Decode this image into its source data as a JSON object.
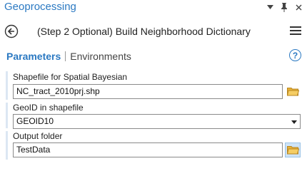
{
  "window": {
    "title": "Geoprocessing"
  },
  "header": {
    "tool_title": "(Step 2 Optional) Build Neighborhood Dictionary"
  },
  "tabs": [
    {
      "label": "Parameters",
      "active": true
    },
    {
      "label": "Environments",
      "active": false
    }
  ],
  "help_glyph": "?",
  "parameters": [
    {
      "label": "Shapefile for Spatial Bayesian",
      "value": "NC_tract_2010prj.shp",
      "control": "file"
    },
    {
      "label": "GeoID in shapefile",
      "value": "GEOID10",
      "control": "dropdown"
    },
    {
      "label": "Output folder",
      "value": "TestData",
      "control": "folder"
    }
  ],
  "colors": {
    "accent": "#2b79c2",
    "folder": "#e8b23a"
  }
}
